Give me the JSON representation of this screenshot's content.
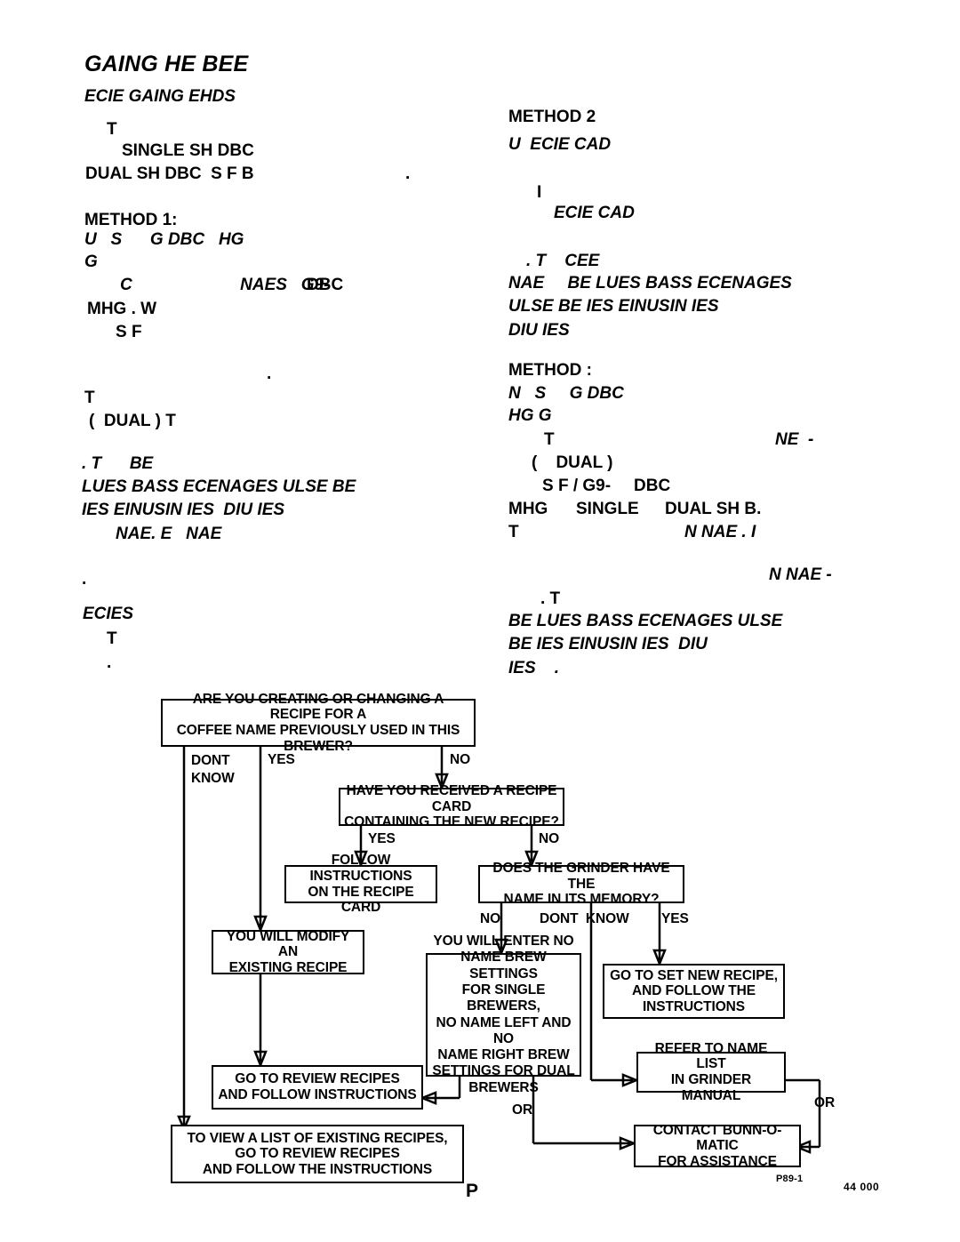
{
  "document": {
    "title": "GAING HE BEE",
    "subtitle": "ECIE GAING EHDS"
  },
  "left_column": {
    "intro": [
      "T",
      "SINGLE SH DBC",
      "DUAL SH DBC  S F B",
      "."
    ],
    "method1": {
      "heading": "METHOD 1:",
      "lines": [
        "U   S      G DBC   HG",
        "G",
        "C                       NAES   G9-",
        "DBC",
        "MHG . W",
        "S F",
        ".",
        "T",
        "(  DUAL ) T",
        ". T      BE",
        "LUES BASS ECENAGES ULSE BE",
        "IES EINUSIN IES  DIU IES",
        "NAE. E   NAE",
        "."
      ]
    },
    "ecies_heading": "ECIES",
    "ecies_lines": [
      "T",
      "."
    ]
  },
  "right_column": {
    "method2": {
      "heading": "METHOD 2",
      "lines": [
        "U  ECIE CAD",
        "I",
        "ECIE CAD",
        ". T    CEE",
        "NAE     BE LUES BASS ECENAGES",
        "ULSE BE IES EINUSIN IES",
        "DIU IES"
      ]
    },
    "method3": {
      "heading": "METHOD :",
      "lines": [
        "N   S     G DBC",
        "HG G",
        "T",
        "NE  -",
        "(    DUAL )",
        "S F / G9-",
        "DBC",
        "MHG      SINGLE",
        "DUAL SH B.",
        "T",
        "N NAE . I",
        "N NAE -",
        ". T",
        "BE LUES BASS ECENAGES ULSE",
        "BE IES EINUSIN IES  DIU",
        "IES    ."
      ]
    }
  },
  "flowchart": {
    "boxes": {
      "q1": "ARE YOU CREATING OR CHANGING A RECIPE FOR A\nCOFFEE NAME PREVIOUSLY USED IN THIS BREWER?",
      "q2": "HAVE YOU RECEIVED A RECIPE CARD\nCONTAINING THE NEW RECIPE?",
      "follow_card": "FOLLOW INSTRUCTIONS\nON THE RECIPE CARD",
      "q3": "DOES THE GRINDER HAVE THE\nNAME IN ITS MEMORY?",
      "modify": "YOU WILL MODIFY AN\nEXISTING RECIPE",
      "enter_no_name": "YOU WILL ENTER NO\nNAME BREW SETTINGS\nFOR SINGLE BREWERS,\nNO NAME LEFT AND NO\nNAME RIGHT BREW\nSETTINGS FOR DUAL\nBREWERS",
      "set_new": "GO TO SET NEW RECIPE,\nAND FOLLOW THE\nINSTRUCTIONS",
      "refer_list": "REFER TO NAME LIST\nIN GRINDER MANUAL",
      "review": "GO TO REVIEW RECIPES\nAND FOLLOW INSTRUCTIONS",
      "contact": "CONTACT BUNN-O-MATIC\nFOR ASSISTANCE",
      "view_list": "TO VIEW A LIST OF EXISTING RECIPES,\nGO TO REVIEW RECIPES\nAND FOLLOW THE INSTRUCTIONS"
    },
    "edge_labels": {
      "dont_know_1": "DONT\nKNOW",
      "yes_1": "YES",
      "no_1": "NO",
      "yes_2": "YES",
      "no_2": "NO",
      "no_3": "NO",
      "dont_know_3": "DONT  KNOW",
      "yes_3": "YES",
      "or_center": "OR",
      "or_right": "OR"
    }
  },
  "footer": {
    "stray_glyph": "P",
    "code": "P89-1",
    "number": "44 000"
  },
  "colors": {
    "ink": "#000000",
    "paper": "#ffffff"
  }
}
